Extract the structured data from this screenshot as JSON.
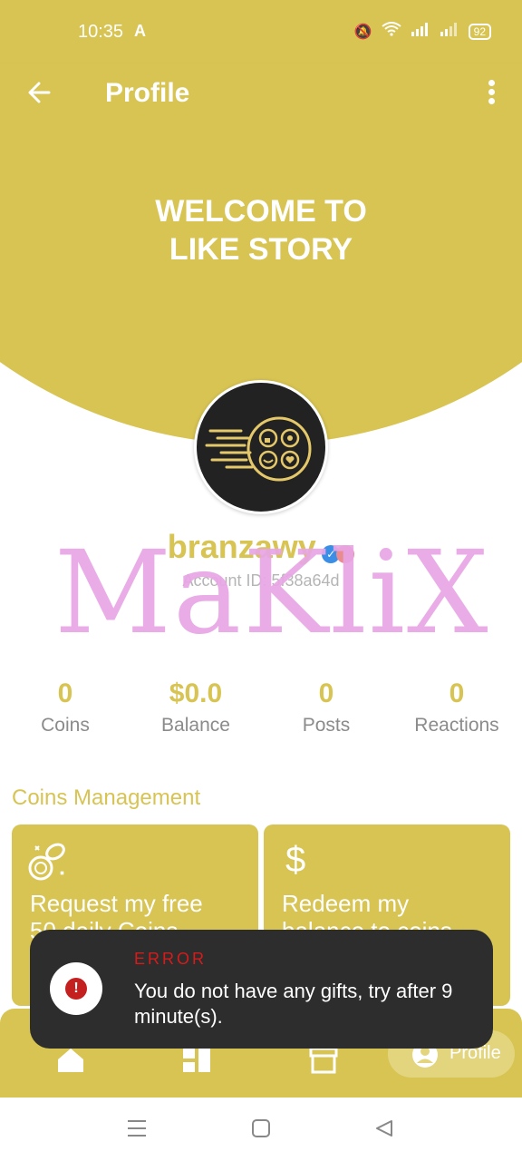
{
  "status_bar": {
    "time": "10:35",
    "app_indicator": "A",
    "battery": "92"
  },
  "app_bar": {
    "title": "Profile"
  },
  "hero": {
    "line1": "WELCOME TO",
    "line2": "LIKE STORY"
  },
  "profile": {
    "username": "branzawy",
    "account_id": "Account ID: 5f38a64d"
  },
  "watermark": "MaKliX",
  "stats": [
    {
      "value": "0",
      "label": "Coins"
    },
    {
      "value": "$0.0",
      "label": "Balance"
    },
    {
      "value": "0",
      "label": "Posts"
    },
    {
      "value": "0",
      "label": "Reactions"
    }
  ],
  "coins_management": {
    "title": "Coins Management",
    "cards": [
      {
        "line1": "Request my free",
        "line2": "50 daily Coins"
      },
      {
        "line1": "Redeem my",
        "line2": "balance to coins"
      }
    ]
  },
  "toast": {
    "title": "ERROR",
    "message": "You do not have any gifts, try after 9 minute(s)."
  },
  "bottom_nav": {
    "profile_label": "Profile"
  },
  "colors": {
    "primary": "#d7c453",
    "watermark": "#e8a6e6",
    "error": "#d71b1b",
    "toast_bg": "#2d2d2d"
  }
}
